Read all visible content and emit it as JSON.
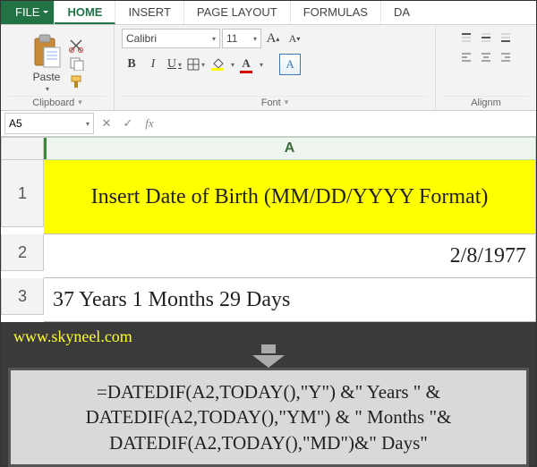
{
  "tabs": {
    "file": "FILE",
    "home": "HOME",
    "insert": "INSERT",
    "page_layout": "PAGE LAYOUT",
    "formulas": "FORMULAS",
    "data_partial": "DA"
  },
  "ribbon": {
    "clipboard": {
      "paste": "Paste",
      "label": "Clipboard"
    },
    "font": {
      "name": "Calibri",
      "size": "11",
      "sampleA": "A",
      "label": "Font"
    },
    "alignment": {
      "label": "Alignm"
    }
  },
  "fx": {
    "namebox": "A5",
    "fx_label": "fx"
  },
  "sheet": {
    "colA": "A",
    "rows": [
      "1",
      "2",
      "3"
    ],
    "a1": "Insert Date of Birth (MM/DD/YYYY Format)",
    "a2": "2/8/1977",
    "a3": "37 Years 1 Months 29 Days"
  },
  "credit": "www.skyneel.com",
  "formula": "=DATEDIF(A2,TODAY(),\"Y\") &\" Years \" & DATEDIF(A2,TODAY(),\"YM\") & \" Months \"& DATEDIF(A2,TODAY(),\"MD\")&\" Days\""
}
